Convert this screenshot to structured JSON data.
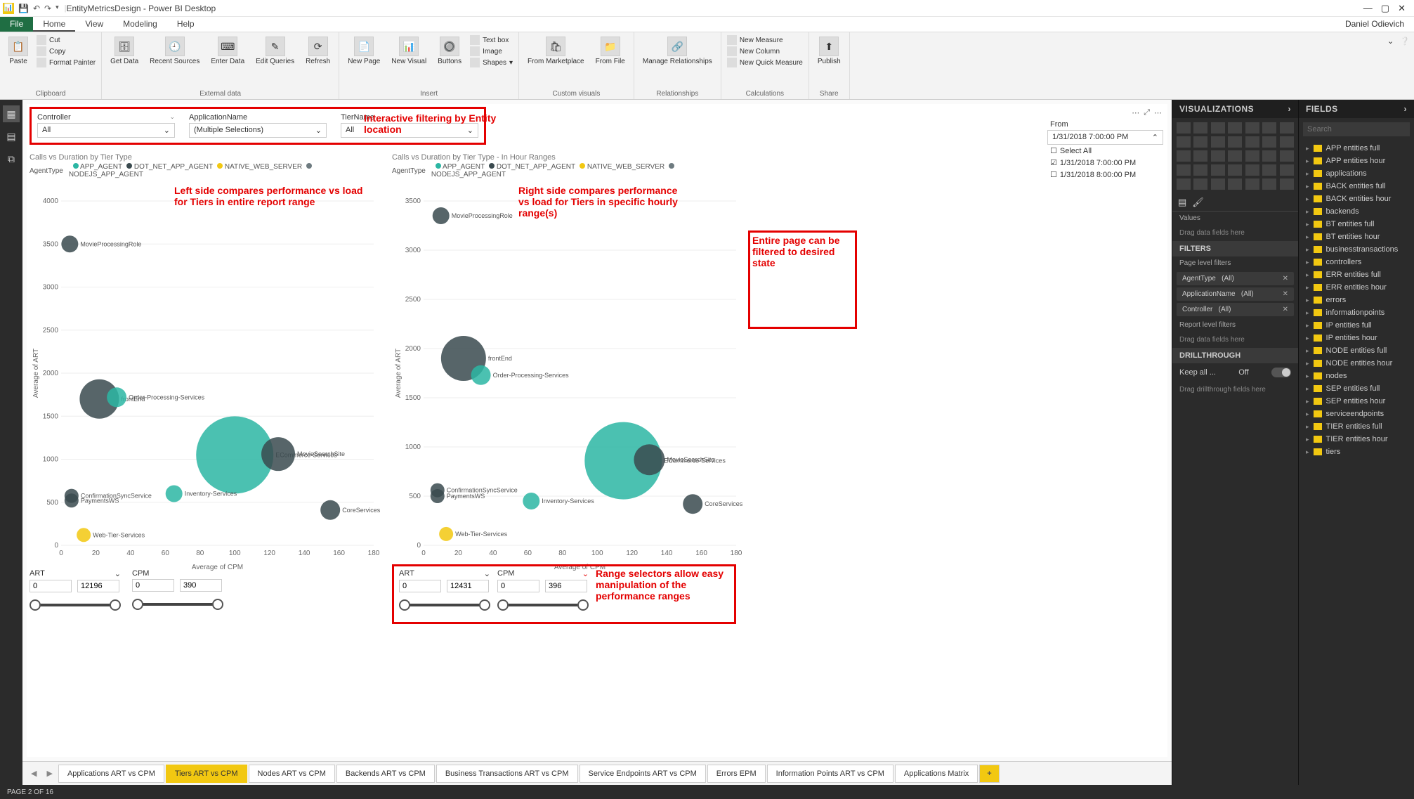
{
  "titlebar": {
    "title": "EntityMetricsDesign - Power BI Desktop"
  },
  "menubar": {
    "file": "File",
    "tabs": [
      "Home",
      "View",
      "Modeling",
      "Help"
    ],
    "user": "Daniel Odievich"
  },
  "ribbon": {
    "clipboard": {
      "paste": "Paste",
      "cut": "Cut",
      "copy": "Copy",
      "format_painter": "Format Painter",
      "group": "Clipboard"
    },
    "external_data": {
      "get_data": "Get\nData",
      "recent": "Recent\nSources",
      "enter": "Enter\nData",
      "edit": "Edit\nQueries",
      "refresh": "Refresh",
      "group": "External data"
    },
    "insert": {
      "new_page": "New\nPage",
      "new_visual": "New\nVisual",
      "buttons": "Buttons",
      "text_box": "Text box",
      "image": "Image",
      "shapes": "Shapes",
      "group": "Insert"
    },
    "custom": {
      "from_marketplace": "From\nMarketplace",
      "from_file": "From\nFile",
      "group": "Custom visuals"
    },
    "relationships": {
      "manage": "Manage\nRelationships",
      "group": "Relationships"
    },
    "calculations": {
      "new_measure": "New Measure",
      "new_column": "New Column",
      "new_quick": "New Quick Measure",
      "group": "Calculations"
    },
    "share": {
      "publish": "Publish",
      "group": "Share"
    }
  },
  "slicers": {
    "controller": {
      "label": "Controller",
      "value": "All"
    },
    "application": {
      "label": "ApplicationName",
      "value": "(Multiple Selections)"
    },
    "tier": {
      "label": "TierName",
      "value": "All"
    }
  },
  "from_slicer": {
    "header": "From",
    "date": "1/31/2018 7:00:00 PM",
    "select_all": "Select All",
    "opt1": "1/31/2018 7:00:00 PM",
    "opt2": "1/31/2018 8:00:00 PM"
  },
  "annotations": {
    "filter_entity": "Interactive filtering by Entity location",
    "left_compare": "Left side compares performance vs load for Tiers in entire report range",
    "right_compare": "Right side compares performance vs load for Tiers in specific hourly range(s)",
    "page_filter": "Entire page can be filtered to desired state",
    "range_sel": "Range selectors allow easy manipulation of the performance ranges"
  },
  "chart_left": {
    "title": "Calls vs Duration by Tier Type",
    "legend_label": "AgentType",
    "x_label": "Average of CPM",
    "y_label": "Average of ART"
  },
  "chart_right": {
    "title": "Calls vs Duration by Tier Type - In Hour Ranges"
  },
  "legend_items": [
    {
      "name": "APP_AGENT",
      "color": "#2bb6a3"
    },
    {
      "name": "DOT_NET_APP_AGENT",
      "color": "#3a4a4f"
    },
    {
      "name": "NATIVE_WEB_SERVER",
      "color": "#f2c811"
    },
    {
      "name": "NODEJS_APP_AGENT",
      "color": "#6e7b80"
    }
  ],
  "chart_data": [
    {
      "type": "scatter",
      "title": "Calls vs Duration by Tier Type",
      "xlabel": "Average of CPM",
      "ylabel": "Average of ART",
      "xlim": [
        0,
        180
      ],
      "ylim": [
        0,
        4000
      ],
      "x_ticks": [
        0,
        20,
        40,
        60,
        80,
        100,
        120,
        140,
        160,
        180
      ],
      "y_ticks": [
        0,
        500,
        1000,
        1500,
        2000,
        2500,
        3000,
        3500,
        4000
      ],
      "series": [
        {
          "name": "MovieProcessingRole",
          "x": 5,
          "y": 3500,
          "size": 12,
          "agent": "DOT_NET_APP_AGENT"
        },
        {
          "name": "frontEnd",
          "x": 22,
          "y": 1700,
          "size": 28,
          "agent": "DOT_NET_APP_AGENT"
        },
        {
          "name": "Order-Processing-Services",
          "x": 32,
          "y": 1720,
          "size": 14,
          "agent": "APP_AGENT"
        },
        {
          "name": "ECommerce-Services",
          "x": 100,
          "y": 1050,
          "size": 55,
          "agent": "APP_AGENT"
        },
        {
          "name": "MovieSearchSite",
          "x": 125,
          "y": 1060,
          "size": 24,
          "agent": "DOT_NET_APP_AGENT"
        },
        {
          "name": "ConfirmationSyncService",
          "x": 6,
          "y": 575,
          "size": 10,
          "agent": "DOT_NET_APP_AGENT"
        },
        {
          "name": "PaymentsWS",
          "x": 6,
          "y": 520,
          "size": 10,
          "agent": "DOT_NET_APP_AGENT"
        },
        {
          "name": "Inventory-Services",
          "x": 65,
          "y": 600,
          "size": 12,
          "agent": "APP_AGENT"
        },
        {
          "name": "CoreServices",
          "x": 155,
          "y": 410,
          "size": 14,
          "agent": "DOT_NET_APP_AGENT"
        },
        {
          "name": "Web-Tier-Services",
          "x": 13,
          "y": 120,
          "size": 10,
          "agent": "NATIVE_WEB_SERVER"
        }
      ]
    },
    {
      "type": "scatter",
      "title": "Calls vs Duration by Tier Type - In Hour Ranges",
      "xlabel": "Average of CPM",
      "ylabel": "Average of ART",
      "xlim": [
        0,
        180
      ],
      "ylim": [
        0,
        3500
      ],
      "x_ticks": [
        0,
        20,
        40,
        60,
        80,
        100,
        120,
        140,
        160,
        180
      ],
      "y_ticks": [
        0,
        500,
        1000,
        1500,
        2000,
        2500,
        3000,
        3500
      ],
      "series": [
        {
          "name": "MovieProcessingRole",
          "x": 10,
          "y": 3350,
          "size": 12,
          "agent": "DOT_NET_APP_AGENT"
        },
        {
          "name": "frontEnd",
          "x": 23,
          "y": 1900,
          "size": 32,
          "agent": "DOT_NET_APP_AGENT"
        },
        {
          "name": "Order-Processing-Services",
          "x": 33,
          "y": 1730,
          "size": 14,
          "agent": "APP_AGENT"
        },
        {
          "name": "ECommerce-Services",
          "x": 115,
          "y": 860,
          "size": 55,
          "agent": "APP_AGENT"
        },
        {
          "name": "MovieSearchSite",
          "x": 130,
          "y": 870,
          "size": 22,
          "agent": "DOT_NET_APP_AGENT"
        },
        {
          "name": "ConfirmationSyncService",
          "x": 8,
          "y": 560,
          "size": 10,
          "agent": "DOT_NET_APP_AGENT"
        },
        {
          "name": "PaymentsWS",
          "x": 8,
          "y": 500,
          "size": 10,
          "agent": "DOT_NET_APP_AGENT"
        },
        {
          "name": "Inventory-Services",
          "x": 62,
          "y": 450,
          "size": 12,
          "agent": "APP_AGENT"
        },
        {
          "name": "CoreServices",
          "x": 155,
          "y": 420,
          "size": 14,
          "agent": "DOT_NET_APP_AGENT"
        },
        {
          "name": "Web-Tier-Services",
          "x": 13,
          "y": 115,
          "size": 10,
          "agent": "NATIVE_WEB_SERVER"
        }
      ]
    }
  ],
  "range_left": {
    "art_label": "ART",
    "art_min": "0",
    "art_max": "12196",
    "cpm_label": "CPM",
    "cpm_min": "0",
    "cpm_max": "390"
  },
  "range_right": {
    "art_label": "ART",
    "art_min": "0",
    "art_max": "12431",
    "cpm_label": "CPM",
    "cpm_min": "0",
    "cpm_max": "396"
  },
  "page_tabs": [
    "Applications ART vs CPM",
    "Tiers ART vs CPM",
    "Nodes ART vs CPM",
    "Backends ART vs CPM",
    "Business Transactions ART vs CPM",
    "Service Endpoints ART vs CPM",
    "Errors EPM",
    "Information Points ART vs CPM",
    "Applications Matrix"
  ],
  "viz_pane": {
    "header": "VISUALIZATIONS",
    "values_hdr": "Values",
    "values_ph": "Drag data fields here",
    "filters_hdr": "FILTERS",
    "page_filters_hdr": "Page level filters",
    "filters": [
      {
        "name": "AgentType",
        "scope": "(All)"
      },
      {
        "name": "ApplicationName",
        "scope": "(All)"
      },
      {
        "name": "Controller",
        "scope": "(All)"
      }
    ],
    "report_filters_hdr": "Report level filters",
    "report_ph": "Drag data fields here",
    "drill_hdr": "DRILLTHROUGH",
    "keep_all": "Keep all ...",
    "off": "Off",
    "drill_ph": "Drag drillthrough fields here"
  },
  "fields_pane": {
    "header": "FIELDS",
    "search_ph": "Search",
    "tables": [
      "APP entities full",
      "APP entities hour",
      "applications",
      "BACK entities full",
      "BACK entities hour",
      "backends",
      "BT entities full",
      "BT entities hour",
      "businesstransactions",
      "controllers",
      "ERR entities full",
      "ERR entities hour",
      "errors",
      "informationpoints",
      "IP entities full",
      "IP entities hour",
      "NODE entities full",
      "NODE entities hour",
      "nodes",
      "SEP entities full",
      "SEP entities hour",
      "serviceendpoints",
      "TIER entities full",
      "TIER entities hour",
      "tiers"
    ]
  },
  "statusbar": {
    "page": "PAGE 2 OF 16"
  }
}
